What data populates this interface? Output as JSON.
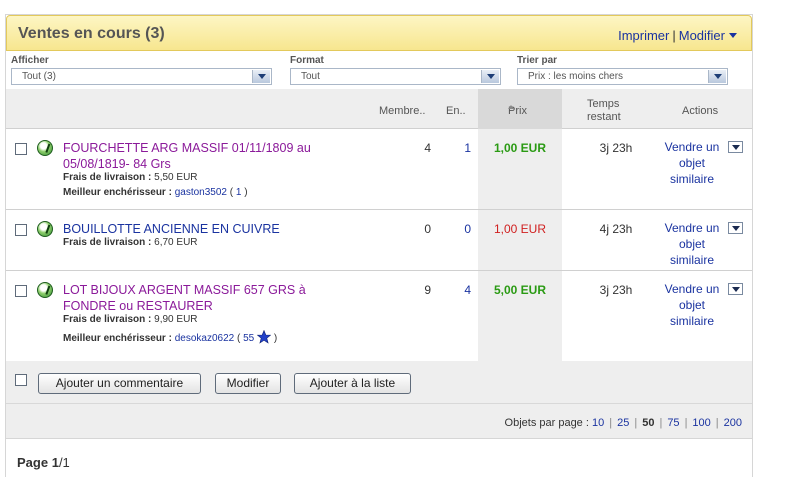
{
  "header": {
    "title": "Ventes en cours (3)",
    "print": "Imprimer",
    "sep": "|",
    "modify": "Modifier"
  },
  "filters": {
    "show_label": "Afficher",
    "show_value": "Tout (3)",
    "format_label": "Format",
    "format_value": "Tout",
    "sort_label": "Trier par",
    "sort_value": "Prix : les moins chers"
  },
  "columns": {
    "members": "Membre..",
    "bids": "En..",
    "price": "Prix",
    "time_left_1": "Temps",
    "time_left_2": "restant",
    "actions": "Actions"
  },
  "items": [
    {
      "title": "FOURCHETTE ARG MASSIF 01/11/1809 au 05/08/1819- 84 Grs",
      "shipping_label": "Frais de livraison :",
      "shipping": "5,50 EUR",
      "bidder_label": "Meilleur enchérisseur :",
      "bidder": "gaston3502",
      "bidder_open": "(",
      "bidder_score": "1",
      "bidder_close": ")",
      "members": "4",
      "bids": "1",
      "price": "1,00 EUR",
      "time": "3j 23h",
      "action": "Vendre un objet similaire"
    },
    {
      "title": "BOUILLOTTE ANCIENNE EN CUIVRE",
      "shipping_label": "Frais de livraison :",
      "shipping": "6,70 EUR",
      "members": "0",
      "bids": "0",
      "price": "1,00 EUR",
      "time": "4j 23h",
      "action": "Vendre un objet similaire"
    },
    {
      "title": "LOT BIJOUX ARGENT MASSIF 657 GRS à FONDRE ou RESTAURER",
      "shipping_label": "Frais de livraison :",
      "shipping": "9,90 EUR",
      "bidder_label": "Meilleur enchérisseur :",
      "bidder": "desokaz0622",
      "bidder_open": "(",
      "bidder_score": "55",
      "bidder_close": ")",
      "members": "9",
      "bids": "4",
      "price": "5,00 EUR",
      "time": "3j 23h",
      "action": "Vendre un objet similaire"
    }
  ],
  "buttons": {
    "comment": "Ajouter un commentaire",
    "modify": "Modifier",
    "add_list": "Ajouter à la liste"
  },
  "pager": {
    "label": "Objets par page :",
    "options": [
      "10",
      "25",
      "50",
      "75",
      "100",
      "200"
    ],
    "current": "50"
  },
  "footer": {
    "page_label": "Page",
    "page_current": "1",
    "page_total": "/1"
  },
  "colors": {
    "title_purple": "#8b1a9a",
    "link_blue": "#1a33a0",
    "price_green": "#2a9a13",
    "price_red": "#d02020",
    "header_yellow": "#f7e68f"
  }
}
